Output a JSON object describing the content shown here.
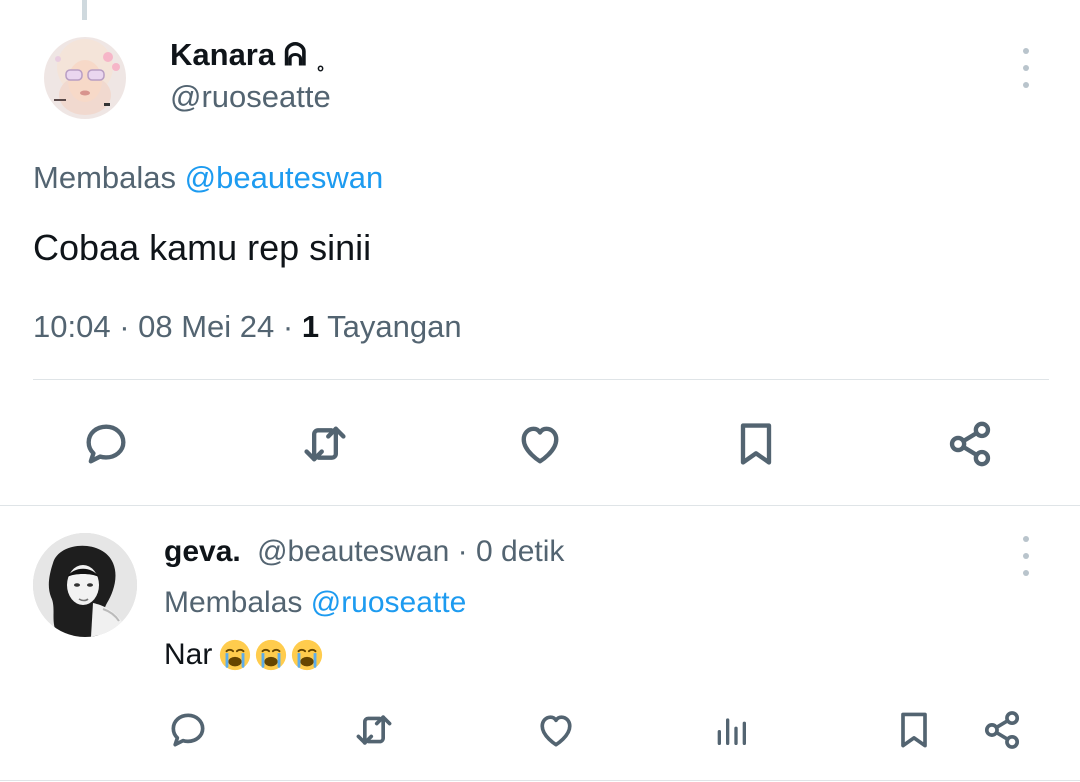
{
  "main_tweet": {
    "display_name": "Kanara ᕱ ˳",
    "handle": "@ruoseatte",
    "replying_label": "Membalas",
    "replying_to": "@beauteswan",
    "text": "Cobaa kamu rep sinii",
    "time": "10:04",
    "date": "08 Mei 24",
    "views_count": "1",
    "views_label": "Tayangan"
  },
  "reply_tweet": {
    "display_name": "geva.",
    "handle": "@beauteswan",
    "time_ago": "0 detik",
    "replying_label": "Membalas",
    "replying_to": "@ruoseatte",
    "text": "Nar",
    "emojis": [
      "loudly-crying-face",
      "loudly-crying-face",
      "loudly-crying-face"
    ]
  },
  "icons": {
    "reply": "speech-bubble-icon",
    "retweet": "retweet-icon",
    "like": "heart-icon",
    "views": "bar-chart-icon",
    "bookmark": "bookmark-icon",
    "share": "share-icon",
    "more": "vertical-ellipsis-icon"
  },
  "colors": {
    "text_primary": "#0f1419",
    "text_secondary": "#536471",
    "link": "#1d9bf0",
    "icon": "#536471",
    "divider": "#dfe4e7"
  }
}
